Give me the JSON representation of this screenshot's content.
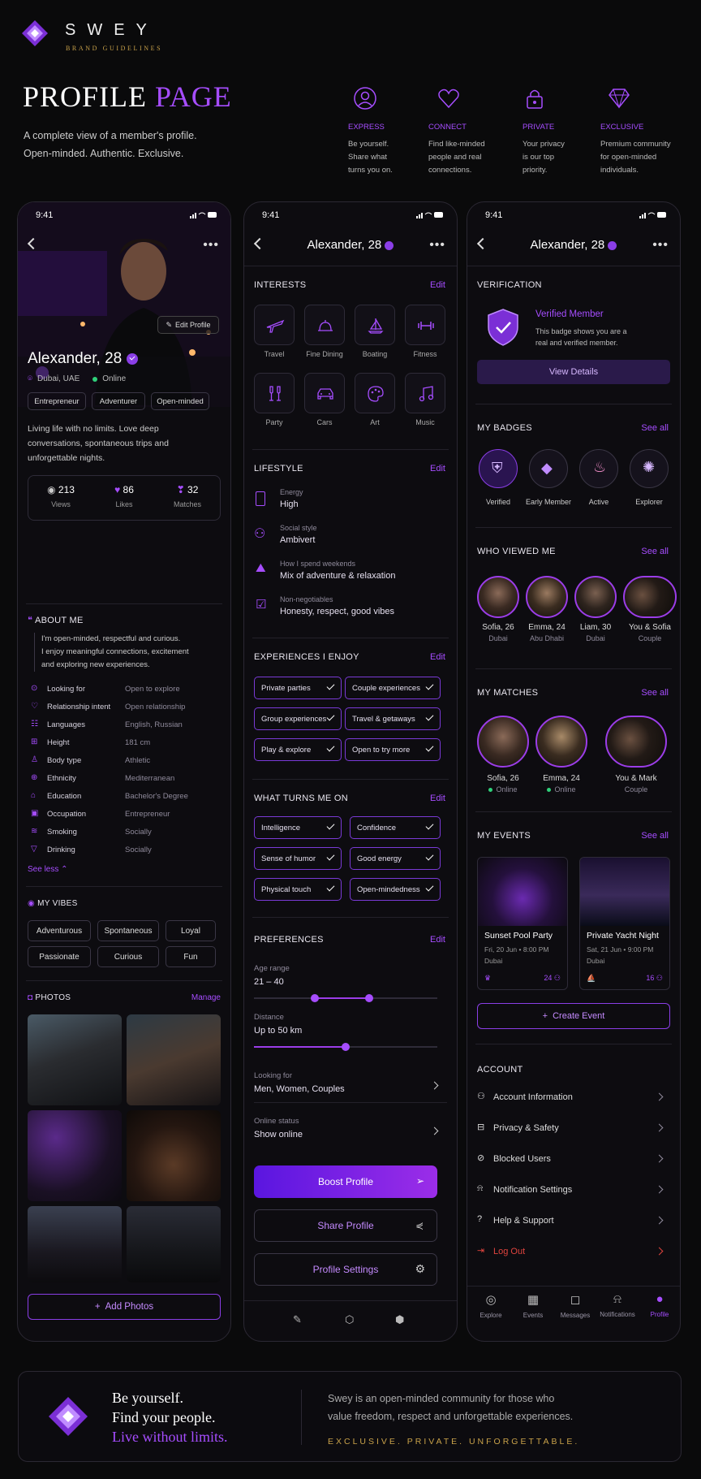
{
  "brand": {
    "name": "SWEY",
    "tagline": "BRAND GUIDELINES"
  },
  "hero": {
    "title_a": "PROFILE",
    "title_b": "PAGE",
    "desc1": "A complete view of a member's profile.",
    "desc2": "Open-minded. Authentic. Exclusive."
  },
  "pillars": [
    {
      "title": "EXPRESS",
      "l1": "Be yourself.",
      "l2": "Share what",
      "l3": "turns you on.",
      "icon": "person-icon"
    },
    {
      "title": "CONNECT",
      "l1": "Find like-minded",
      "l2": "people and real",
      "l3": "connections.",
      "icon": "heart-icon"
    },
    {
      "title": "PRIVATE",
      "l1": "Your privacy",
      "l2": "is our top",
      "l3": "priority.",
      "icon": "lock-icon"
    },
    {
      "title": "EXCLUSIVE",
      "l1": "Premium community",
      "l2": "for open-minded",
      "l3": "individuals.",
      "icon": "diamond-icon"
    }
  ],
  "status": {
    "time": "9:41"
  },
  "p1": {
    "edit_profile": "Edit Profile",
    "name": "Alexander, 28",
    "location": "Dubai, UAE",
    "online": "Online",
    "tags": [
      "Entrepreneur",
      "Adventurer",
      "Open-minded"
    ],
    "bio1": "Living life with no limits. Love deep",
    "bio2": "conversations, spontaneous trips and",
    "bio3": "unforgettable nights.",
    "stats": [
      {
        "v": "213",
        "l": "Views"
      },
      {
        "v": "86",
        "l": "Likes"
      },
      {
        "v": "32",
        "l": "Matches"
      }
    ],
    "about_h": "ABOUT ME",
    "about1": "I'm open-minded, respectful and curious.",
    "about2": "I enjoy meaningful connections, excitement",
    "about3": "and exploring new experiences.",
    "info": [
      {
        "k": "Looking for",
        "v": "Open to explore"
      },
      {
        "k": "Relationship intent",
        "v": "Open relationship"
      },
      {
        "k": "Languages",
        "v": "English, Russian"
      },
      {
        "k": "Height",
        "v": "181 cm"
      },
      {
        "k": "Body type",
        "v": "Athletic"
      },
      {
        "k": "Ethnicity",
        "v": "Mediterranean"
      },
      {
        "k": "Education",
        "v": "Bachelor's Degree"
      },
      {
        "k": "Occupation",
        "v": "Entrepreneur"
      },
      {
        "k": "Smoking",
        "v": "Socially"
      },
      {
        "k": "Drinking",
        "v": "Socially"
      }
    ],
    "see_less": "See less",
    "vibes_h": "MY VIBES",
    "vibes": [
      "Adventurous",
      "Spontaneous",
      "Loyal",
      "Passionate",
      "Curious",
      "Fun"
    ],
    "photos_h": "PHOTOS",
    "manage": "Manage",
    "add_photos": "Add Photos"
  },
  "p2": {
    "title": "Alexander, 28",
    "edit": "Edit",
    "interests_h": "INTERESTS",
    "interests": [
      "Travel",
      "Fine Dining",
      "Boating",
      "Fitness",
      "Party",
      "Cars",
      "Art",
      "Music"
    ],
    "lifestyle_h": "LIFESTYLE",
    "lifestyle": [
      {
        "k": "Energy",
        "v": "High"
      },
      {
        "k": "Social style",
        "v": "Ambivert"
      },
      {
        "k": "How I spend weekends",
        "v": "Mix of adventure & relaxation"
      },
      {
        "k": "Non-negotiables",
        "v": "Honesty, respect, good vibes"
      }
    ],
    "exp_h": "EXPERIENCES I ENJOY",
    "exp": [
      "Private parties",
      "Couple experiences",
      "Group experiences",
      "Travel & getaways",
      "Play & explore",
      "Open to try more"
    ],
    "turn_h": "WHAT TURNS ME ON",
    "turn": [
      "Intelligence",
      "Confidence",
      "Sense of humor",
      "Good energy",
      "Physical touch",
      "Open-mindedness"
    ],
    "pref_h": "PREFERENCES",
    "age_k": "Age range",
    "age_v": "21 – 40",
    "age_lo": 0.33,
    "age_hi": 0.63,
    "dist_k": "Distance",
    "dist_v": "Up to 50 km",
    "dist_fill": 0.5,
    "look_k": "Looking for",
    "look_v": "Men, Women, Couples",
    "onl_k": "Online status",
    "onl_v": "Show online",
    "boost": "Boost Profile",
    "share": "Share Profile",
    "settings": "Profile Settings"
  },
  "p3": {
    "title": "Alexander, 28",
    "ver_h": "VERIFICATION",
    "ver_t": "Verified Member",
    "ver_d1": "This badge shows you are a",
    "ver_d2": "real and verified member.",
    "ver_btn": "View Details",
    "badges_h": "MY BADGES",
    "see_all": "See all",
    "badges": [
      "Verified",
      "Early Member",
      "Active",
      "Explorer"
    ],
    "viewed_h": "WHO VIEWED ME",
    "viewed": [
      {
        "n": "Sofia, 26",
        "s": "Dubai"
      },
      {
        "n": "Emma, 24",
        "s": "Abu Dhabi"
      },
      {
        "n": "Liam, 30",
        "s": "Dubai"
      },
      {
        "n": "You & Sofia",
        "s": "Couple"
      }
    ],
    "matches_h": "MY MATCHES",
    "matches": [
      {
        "n": "Sofia, 26",
        "s": "Online"
      },
      {
        "n": "Emma, 24",
        "s": "Online"
      },
      {
        "n": "You & Mark",
        "s": "Couple"
      }
    ],
    "events_h": "MY EVENTS",
    "events": [
      {
        "t": "Sunset Pool Party",
        "d": "Fri, 20 Jun • 8:00 PM",
        "p": "Dubai",
        "c": "24"
      },
      {
        "t": "Private Yacht Night",
        "d": "Sat, 21 Jun • 9:00 PM",
        "p": "Dubai",
        "c": "16"
      }
    ],
    "create": "Create Event",
    "account_h": "ACCOUNT",
    "account": [
      "Account Information",
      "Privacy & Safety",
      "Blocked Users",
      "Notification Settings",
      "Help & Support"
    ],
    "logout": "Log Out",
    "tabs": [
      "Explore",
      "Events",
      "Messages",
      "Notifications",
      "Profile"
    ]
  },
  "footer": {
    "l1": "Be yourself.",
    "l2": "Find your people.",
    "l3": "Live without limits.",
    "d1": "Swey is an open-minded community for those who",
    "d2": "value freedom, respect and unforgettable experiences.",
    "tag": "EXCLUSIVE.  PRIVATE.  UNFORGETTABLE."
  },
  "colors": {
    "accent": "#a64dff",
    "gold": "#c9a24a",
    "bg": "#0a0a0b",
    "logout": "#e0443e"
  }
}
